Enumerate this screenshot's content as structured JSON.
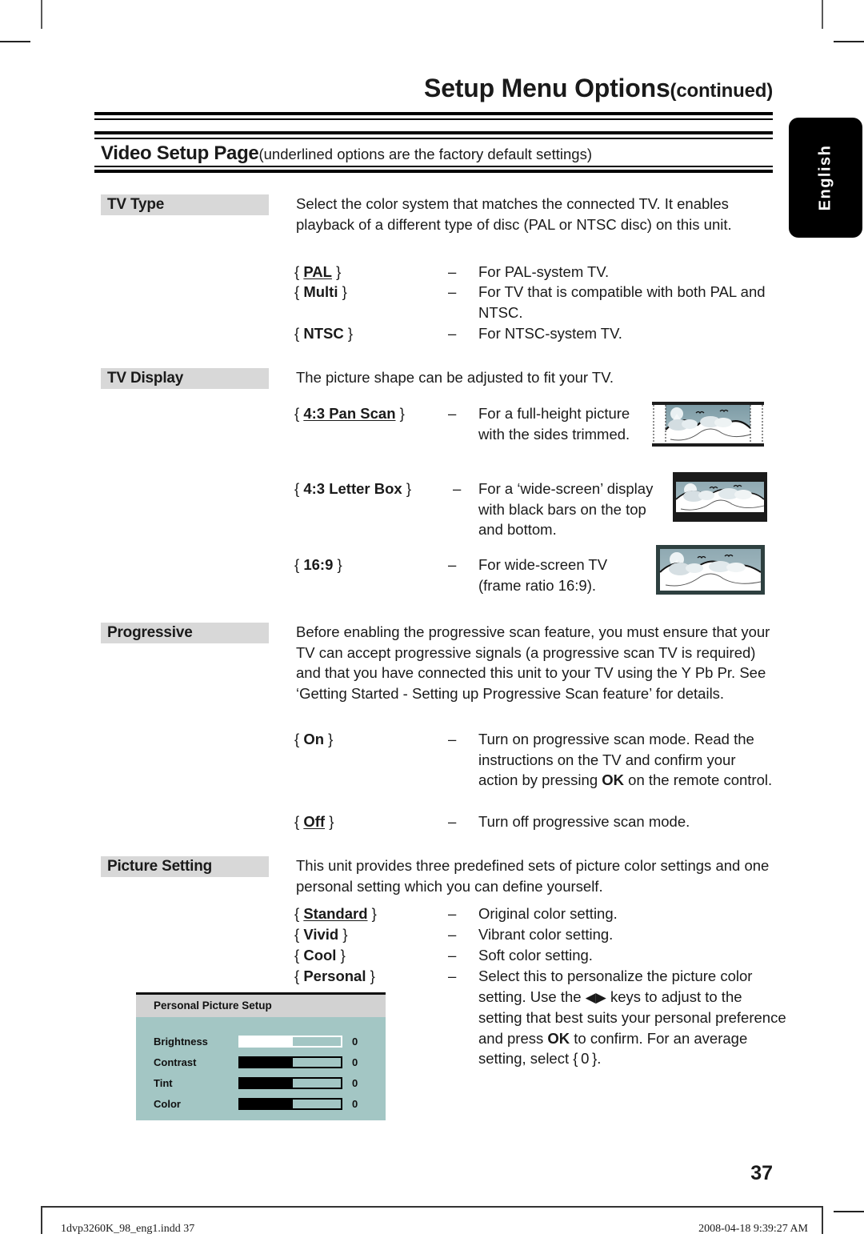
{
  "page": {
    "title_main": "Setup Menu Options",
    "title_continued": "(continued)",
    "number": "37",
    "side_tab": "English"
  },
  "band": {
    "title": "Video Setup Page",
    "subtitle": "(underlined options are the factory default settings)"
  },
  "sections": {
    "tv_type": {
      "label": "TV Type",
      "intro": "Select the color system that matches the connected TV. It enables playback of a different type of disc (PAL or NTSC disc) on this unit.",
      "options": [
        {
          "open": "{",
          "name": "PAL",
          "close": "}",
          "underlined": true,
          "dash": "–",
          "desc": "For PAL-system TV."
        },
        {
          "open": "{",
          "name": "Multi",
          "close": "}",
          "underlined": false,
          "dash": "–",
          "desc": "For TV that is compatible with both PAL and NTSC."
        },
        {
          "open": "{",
          "name": "NTSC",
          "close": "}",
          "underlined": false,
          "dash": "–",
          "desc": "For NTSC-system TV."
        }
      ]
    },
    "tv_display": {
      "label": "TV Display",
      "intro": "The picture shape can be adjusted to fit your TV.",
      "options": [
        {
          "open": "{",
          "name": "4:3 Pan Scan",
          "close": "}",
          "underlined": true,
          "dash": "–",
          "desc": "For a full-height picture with the sides trimmed.",
          "thumb": "pan-scan-thumbnail"
        },
        {
          "open": "{",
          "name": "4:3 Letter Box",
          "close": "}",
          "underlined": false,
          "dash": "–",
          "desc": "For a ‘wide-screen’ display with black bars on the top and bottom.",
          "thumb": "letter-box-thumbnail"
        },
        {
          "open": "{",
          "name": "16:9",
          "close": "}",
          "underlined": false,
          "dash": "–",
          "desc": "For wide-screen TV (frame ratio 16:9).",
          "thumb": "widescreen-thumbnail"
        }
      ]
    },
    "progressive": {
      "label": "Progressive",
      "intro": "Before enabling the progressive scan feature, you must ensure that your TV can accept progressive signals (a progressive scan TV is required) and that you have connected this unit to your TV using the Y Pb Pr. See ‘Getting Started - Setting up Progressive Scan feature’ for details.",
      "options": [
        {
          "open": "{",
          "name": "On",
          "close": "}",
          "underlined": false,
          "dash": "–",
          "desc_pre": "Turn on progressive scan mode. Read the instructions on the TV and confirm your action by pressing ",
          "desc_bold": "OK",
          "desc_post": " on the remote control."
        },
        {
          "open": "{",
          "name": "Off",
          "close": "}",
          "underlined": true,
          "dash": "–",
          "desc": "Turn off progressive scan mode."
        }
      ]
    },
    "picture_setting": {
      "label": "Picture Setting",
      "intro": "This unit provides three predefined sets of picture color settings and one personal setting which you can define yourself.",
      "options": [
        {
          "open": "{",
          "name": "Standard",
          "close": "}",
          "underlined": true,
          "dash": "–",
          "desc": "Original color setting."
        },
        {
          "open": "{",
          "name": "Vivid",
          "close": "}",
          "underlined": false,
          "dash": "–",
          "desc": "Vibrant color setting."
        },
        {
          "open": "{",
          "name": "Cool",
          "close": "}",
          "underlined": false,
          "dash": "–",
          "desc": "Soft color setting."
        },
        {
          "open": "{",
          "name": "Personal",
          "close": "}",
          "underlined": false,
          "dash": "–",
          "desc_p1": "Select this to personalize the picture color setting. Use the ",
          "desc_arrows": "◀▶",
          "desc_p2": " keys to adjust to the setting that best suits your personal preference and press ",
          "desc_bold": "OK",
          "desc_p3": " to confirm. For an average setting, select { 0 }."
        }
      ]
    }
  },
  "personal_picture_setup": {
    "header": "Personal Picture Setup",
    "rows": [
      {
        "name": "Brightness",
        "value": "0",
        "fill_percent": 52,
        "selected": true
      },
      {
        "name": "Contrast",
        "value": "0",
        "fill_percent": 52,
        "selected": false
      },
      {
        "name": "Tint",
        "value": "0",
        "fill_percent": 52,
        "selected": false
      },
      {
        "name": "Color",
        "value": "0",
        "fill_percent": 52,
        "selected": false
      }
    ],
    "panel_color": "#a3c6c4",
    "header_color": "#d2d2d2"
  },
  "footer": {
    "left": "1dvp3260K_98_eng1.indd   37",
    "right": "2008-04-18   9:39:27 AM"
  }
}
